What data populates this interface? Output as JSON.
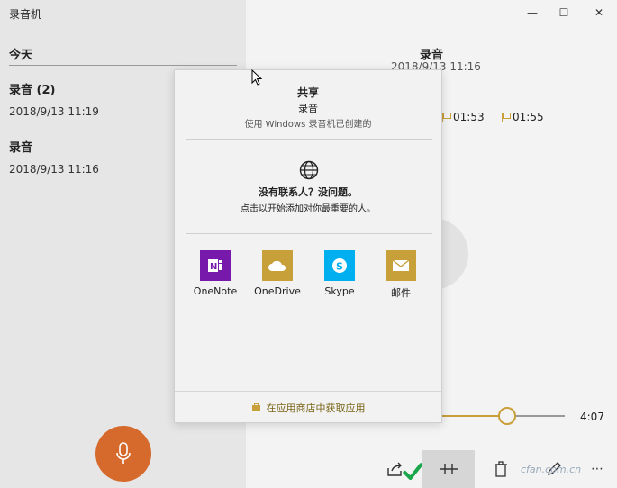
{
  "app": {
    "title": "录音机"
  },
  "window_controls": {
    "minimize": "—",
    "maximize": "☐",
    "close": "✕"
  },
  "left": {
    "group_header": "今天",
    "recordings": [
      {
        "name": "录音 (2)",
        "date": "2018/9/13 11:19"
      },
      {
        "name": "录音",
        "date": "2018/9/13 11:16"
      }
    ]
  },
  "detail": {
    "title": "录音",
    "date": "2018/9/13 11:16",
    "markers": [
      "01:53",
      "01:55"
    ],
    "duration": "4:07",
    "progress_fraction": 0.53
  },
  "share": {
    "title": "共享",
    "item": "录音",
    "created_with": "使用 Windows 录音机已创建的",
    "no_contacts": "没有联系人？没问题。",
    "hint": "点击以开始添加对你最重要的人。",
    "apps": [
      {
        "label": "OneNote",
        "color": "#7719aa",
        "icon": "onenote-icon"
      },
      {
        "label": "OneDrive",
        "color": "#c8a03a",
        "icon": "onedrive-icon"
      },
      {
        "label": "Skype",
        "color": "#00aff0",
        "icon": "skype-icon"
      },
      {
        "label": "邮件",
        "color": "#c8a03a",
        "icon": "mail-icon"
      }
    ],
    "store_link": "在应用商店中获取应用"
  },
  "watermark": "cfan.com.cn",
  "colors": {
    "accent": "#c8a03a",
    "record": "#d56a2c"
  }
}
